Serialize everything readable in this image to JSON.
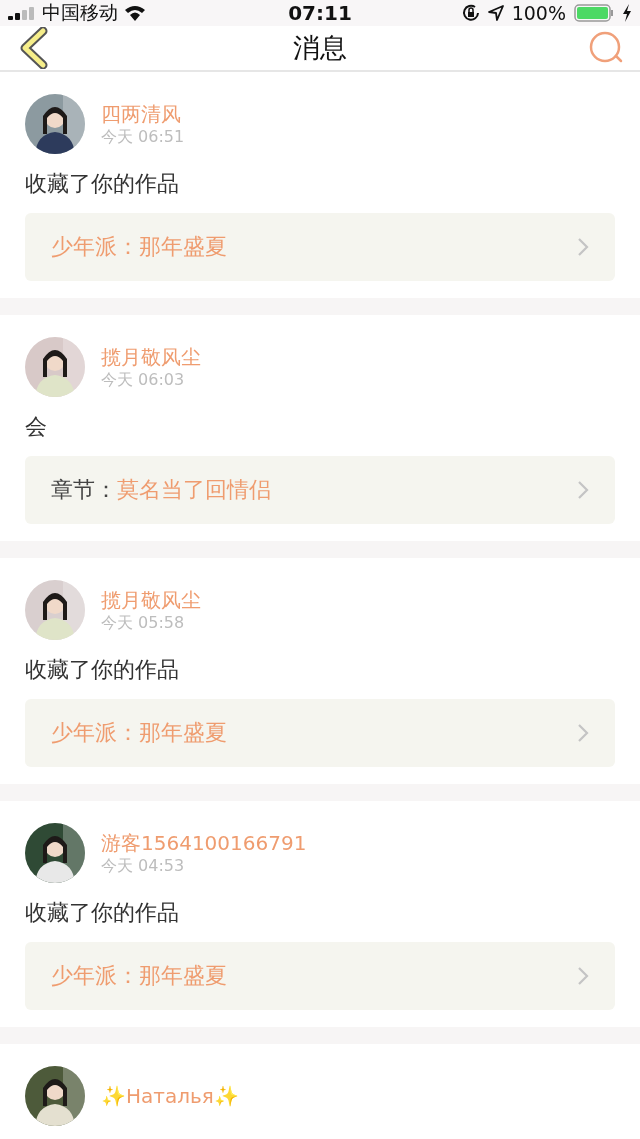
{
  "status_bar": {
    "carrier": "中国移动",
    "time": "07:11",
    "battery": "100%"
  },
  "nav": {
    "title": "消息"
  },
  "messages": [
    {
      "name": "四两清风",
      "time": "今天 06:51",
      "text": "收藏了你的作品",
      "link": {
        "kind": "work",
        "text": "少年派：那年盛夏"
      }
    },
    {
      "name": "揽月敬风尘",
      "time": "今天 06:03",
      "text": "会",
      "link": {
        "kind": "chapter",
        "label": "章节：",
        "text": "莫名当了回情侣"
      }
    },
    {
      "name": "揽月敬风尘",
      "time": "今天 05:58",
      "text": "收藏了你的作品",
      "link": {
        "kind": "work",
        "text": "少年派：那年盛夏"
      }
    },
    {
      "name": "游客1564100166791",
      "time": "今天 04:53",
      "text": "收藏了你的作品",
      "link": {
        "kind": "work",
        "text": "少年派：那年盛夏"
      }
    },
    {
      "name": "✨Наталья✨"
    }
  ]
}
